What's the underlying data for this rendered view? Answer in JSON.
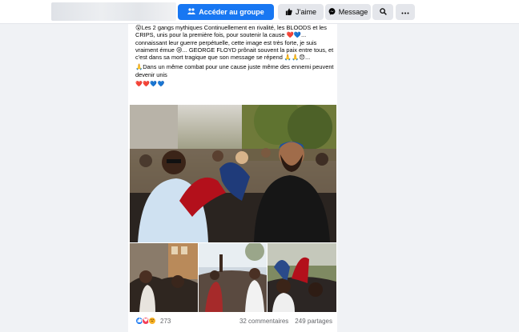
{
  "topbar": {
    "access_group_label": "Accéder au groupe",
    "like_label": "J’aime",
    "message_label": "Message",
    "search_icon": "search-icon",
    "more_icon": "more-dots-icon",
    "primary_color": "#1877f2"
  },
  "post": {
    "paragraph1": "😮Les 2 gangs mythiques Continuellement en rivalité, les BLOODS et les CRIPS, unis pour la première fois, pour soutenir la cause ❤️💙... connaissant leur guerre perpétuelle, cette image est très forte, je suis vraiment émue 😢... GEORGE FLOYD prônait souvent la paix entre tous, et c'est dans sa mort tragique que son message se répend 🙏🙏😞...",
    "paragraph2": "🙏Dans un même combat pour une cause juste même des ennemi peuvent devenir unis",
    "hearts": "❤️❤️💙💙"
  },
  "footer": {
    "reaction_count": "273",
    "comments": "32 commentaires",
    "shares": "249 partages"
  }
}
